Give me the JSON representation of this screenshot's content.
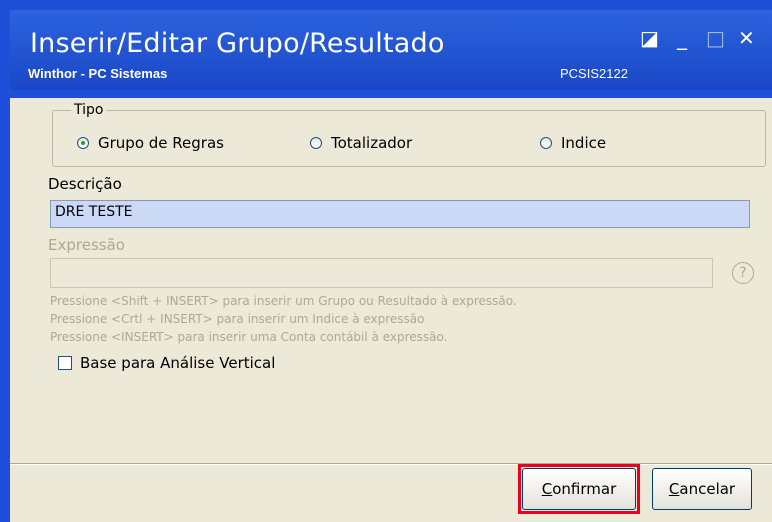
{
  "window": {
    "title": "Inserir/Editar Grupo/Resultado",
    "subtitle": "Winthor - PC Sistemas",
    "code": "PCSIS2122",
    "controls": {
      "restore": "◪",
      "minimize": "_",
      "maximize": "□",
      "close": "✕"
    }
  },
  "tipo": {
    "legend": "Tipo",
    "options": [
      "Grupo de Regras",
      "Totalizador",
      "Indice"
    ],
    "selected": "Grupo de Regras"
  },
  "descricao": {
    "label": "Descrição",
    "value": "DRE TESTE"
  },
  "expressao": {
    "label": "Expressão",
    "value": ""
  },
  "help": {
    "glyph": "?"
  },
  "hints": [
    "Pressione <Shift + INSERT> para inserir um Grupo ou Resultado à expressão.",
    "Pressione <Crtl + INSERT> para inserir um Indice à expressão",
    "Pressione <INSERT> para inserir uma Conta contábil à expressão."
  ],
  "checkbox": {
    "label": "Base para Análise Vertical",
    "checked": false
  },
  "buttons": {
    "confirm_first": "C",
    "confirm_rest": "onfirmar",
    "cancel_first": "C",
    "cancel_rest": "ancelar"
  },
  "colors": {
    "titlebar": "#1d4fd8",
    "highlight": "#e8001c",
    "input_active": "#cbd9f6",
    "face": "#ece9d8"
  }
}
